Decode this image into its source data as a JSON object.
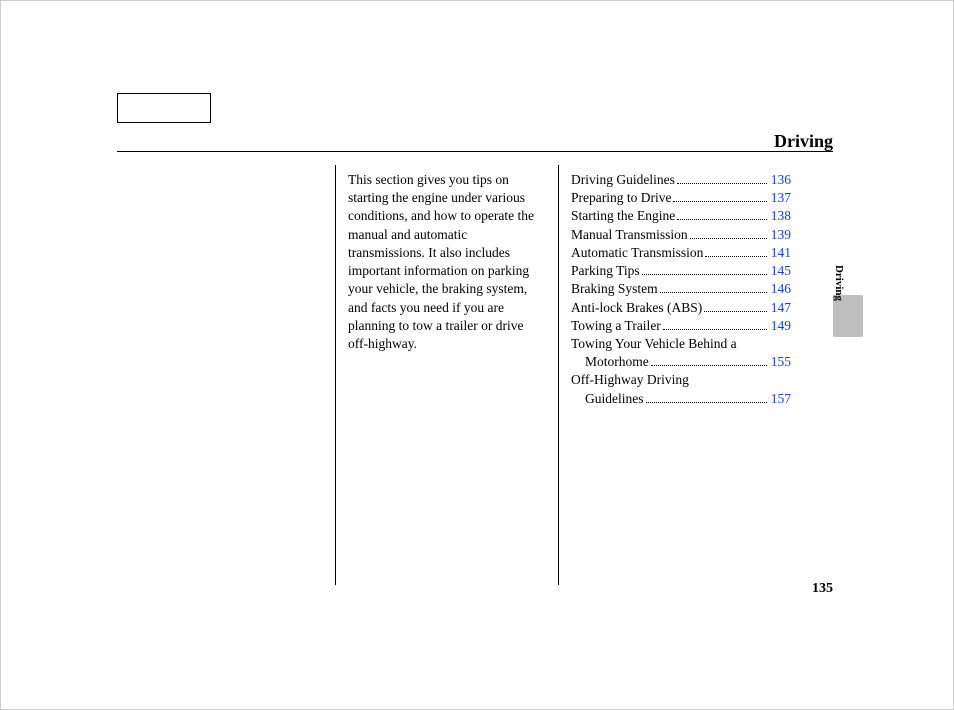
{
  "header": {
    "section_title": "Driving"
  },
  "intro": {
    "text": "This section gives you tips on starting the engine under various conditions, and how to operate the manual and automatic transmissions. It also includes important information on parking your vehicle, the braking system, and facts you need if you are planning to tow a trailer or drive off-highway."
  },
  "toc": {
    "items": [
      {
        "title": "Driving Guidelines",
        "page": "136",
        "indent": false,
        "has_page": true
      },
      {
        "title": "Preparing to Drive",
        "page": "137",
        "indent": false,
        "has_page": true
      },
      {
        "title": "Starting the Engine",
        "page": "138",
        "indent": false,
        "has_page": true
      },
      {
        "title": "Manual Transmission",
        "page": "139",
        "indent": false,
        "has_page": true
      },
      {
        "title": "Automatic Transmission",
        "page": "141",
        "indent": false,
        "has_page": true
      },
      {
        "title": "Parking Tips",
        "page": "145",
        "indent": false,
        "has_page": true
      },
      {
        "title": "Braking System",
        "page": "146",
        "indent": false,
        "has_page": true
      },
      {
        "title": "Anti-lock Brakes (ABS)",
        "page": "147",
        "indent": false,
        "has_page": true
      },
      {
        "title": "Towing a Trailer",
        "page": "149",
        "indent": false,
        "has_page": true
      },
      {
        "title": "Towing Your Vehicle Behind a",
        "page": "",
        "indent": false,
        "has_page": false
      },
      {
        "title": "Motorhome",
        "page": "155",
        "indent": true,
        "has_page": true
      },
      {
        "title": "Off-Highway Driving",
        "page": "",
        "indent": false,
        "has_page": false
      },
      {
        "title": "Guidelines",
        "page": "157",
        "indent": true,
        "has_page": true
      }
    ]
  },
  "side_tab": {
    "label": "Driving"
  },
  "footer": {
    "page_number": "135"
  }
}
